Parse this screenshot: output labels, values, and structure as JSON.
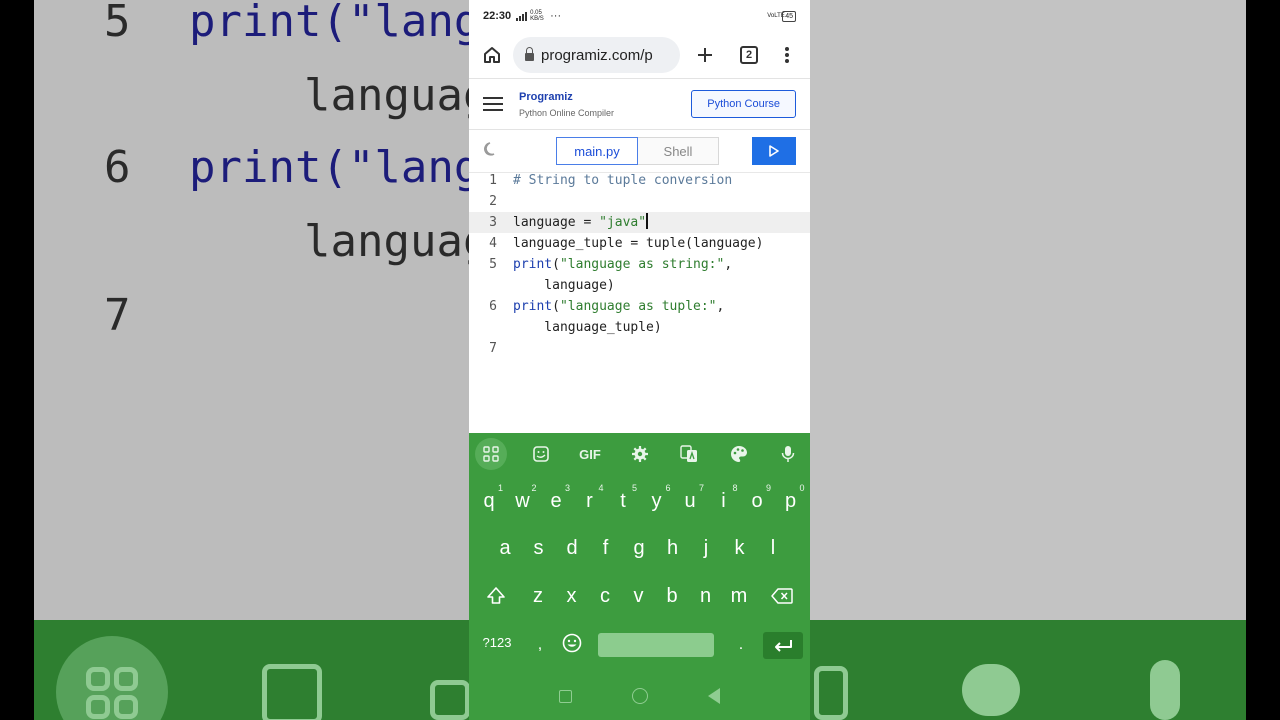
{
  "status": {
    "time": "22:30",
    "net": "0.05 KB/S",
    "dots": "···",
    "lte": "VoLTE",
    "battery": "45"
  },
  "browser": {
    "url": "programiz.com/p",
    "tab_count": "2"
  },
  "site": {
    "brand": "Programiz",
    "subtitle": "Python Online Compiler",
    "course_button": "Python Course"
  },
  "toolbar": {
    "tab_main": "main.py",
    "tab_shell": "Shell"
  },
  "editor": {
    "line_numbers": [
      "1",
      "2",
      "3",
      "4",
      "5",
      "6",
      "7"
    ],
    "lines": [
      "# String to tuple conversion",
      "",
      "language = \"java\"",
      "language_tuple = tuple(language)",
      "print(\"language as string:\",",
      "    language)",
      "print(\"language as tuple:\",",
      "    language_tuple)"
    ]
  },
  "background": {
    "row5_num": "5",
    "row5_code": "print(\"language as string:\",",
    "row5_cont": "language)",
    "row6_num": "6",
    "row6_code": "print(\"language as tuple:\",",
    "row6_cont": "language_tuple)",
    "row7_num": "7"
  },
  "keyboard": {
    "gif": "GIF",
    "row1": [
      "q",
      "w",
      "e",
      "r",
      "t",
      "y",
      "u",
      "i",
      "o",
      "p"
    ],
    "row1_hints": [
      "1",
      "2",
      "3",
      "4",
      "5",
      "6",
      "7",
      "8",
      "9",
      "0"
    ],
    "row2": [
      "a",
      "s",
      "d",
      "f",
      "g",
      "h",
      "j",
      "k",
      "l"
    ],
    "row3": [
      "z",
      "x",
      "c",
      "v",
      "b",
      "n",
      "m"
    ],
    "symbols": "?123",
    "comma": ",",
    "period": "."
  },
  "colors": {
    "keyboard_bg": "#3d9c3f",
    "run_button": "#1f6fe5",
    "brand_blue": "#1d4ed8"
  }
}
